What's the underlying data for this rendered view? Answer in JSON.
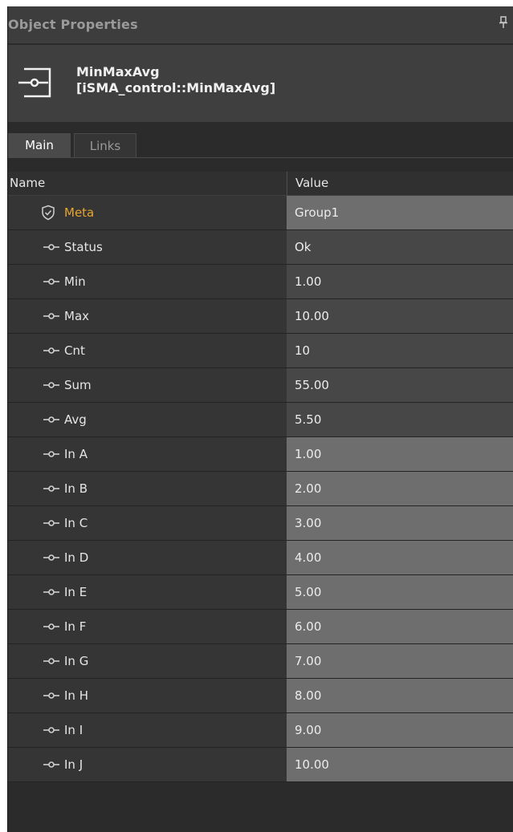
{
  "panel": {
    "title": "Object Properties",
    "header": {
      "name": "MinMaxAvg",
      "type": "[iSMA_control::MinMaxAvg]"
    },
    "tabs": [
      "Main",
      "Links"
    ],
    "active_tab": "Main",
    "columns": {
      "name": "Name",
      "value": "Value"
    },
    "rows": [
      {
        "label": "Meta",
        "value": "Group1",
        "icon": "shield-icon"
      },
      {
        "label": "Status",
        "value": "Ok",
        "icon": "slot-icon"
      },
      {
        "label": "Min",
        "value": "1.00",
        "icon": "slot-icon"
      },
      {
        "label": "Max",
        "value": "10.00",
        "icon": "slot-icon"
      },
      {
        "label": "Cnt",
        "value": "10",
        "icon": "slot-icon"
      },
      {
        "label": "Sum",
        "value": "55.00",
        "icon": "slot-icon"
      },
      {
        "label": "Avg",
        "value": "5.50",
        "icon": "slot-icon"
      },
      {
        "label": "In A",
        "value": "1.00",
        "icon": "slot-icon"
      },
      {
        "label": "In B",
        "value": "2.00",
        "icon": "slot-icon"
      },
      {
        "label": "In C",
        "value": "3.00",
        "icon": "slot-icon"
      },
      {
        "label": "In D",
        "value": "4.00",
        "icon": "slot-icon"
      },
      {
        "label": "In E",
        "value": "5.00",
        "icon": "slot-icon"
      },
      {
        "label": "In F",
        "value": "6.00",
        "icon": "slot-icon"
      },
      {
        "label": "In G",
        "value": "7.00",
        "icon": "slot-icon"
      },
      {
        "label": "In H",
        "value": "8.00",
        "icon": "slot-icon"
      },
      {
        "label": "In I",
        "value": "9.00",
        "icon": "slot-icon"
      },
      {
        "label": "In J",
        "value": "10.00",
        "icon": "slot-icon"
      }
    ]
  },
  "colors": {
    "panel_bg": "#2b2b2b",
    "meta_label": "#e7a531",
    "editable_value_bg": "#6e6e6e",
    "readonly_value_bg": "#474747"
  }
}
